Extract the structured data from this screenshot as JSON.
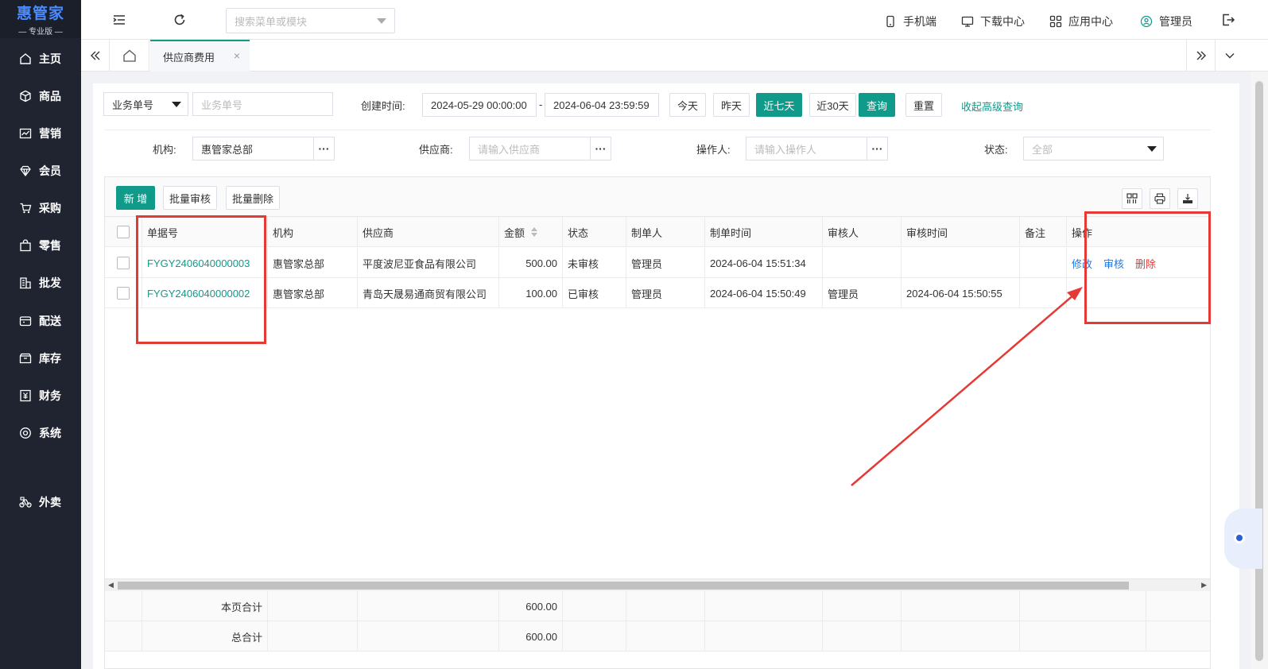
{
  "logo": {
    "main": "惠管家",
    "sub": "— 专业版 —"
  },
  "sidebar": {
    "items": [
      {
        "label": "主页",
        "icon": "home-icon"
      },
      {
        "label": "商品",
        "icon": "box-icon"
      },
      {
        "label": "营销",
        "icon": "chart-icon"
      },
      {
        "label": "会员",
        "icon": "diamond-icon"
      },
      {
        "label": "采购",
        "icon": "cart-icon"
      },
      {
        "label": "零售",
        "icon": "shop-bag-icon"
      },
      {
        "label": "批发",
        "icon": "building-icon"
      },
      {
        "label": "配送",
        "icon": "delivery-icon"
      },
      {
        "label": "库存",
        "icon": "inventory-icon"
      },
      {
        "label": "财务",
        "icon": "finance-icon"
      },
      {
        "label": "系统",
        "icon": "settings-icon"
      },
      {
        "label": "外卖",
        "icon": "bike-icon"
      }
    ]
  },
  "topbar": {
    "search_placeholder": "搜索菜单或模块",
    "mobile": "手机端",
    "download": "下载中心",
    "apps": "应用中心",
    "user": "管理员"
  },
  "tabs": {
    "active": "供应商费用",
    "close": "×"
  },
  "filters": {
    "doc_type": "业务单号",
    "doc_placeholder": "业务单号",
    "created_label": "创建时间:",
    "date_from": "2024-05-29 00:00:00",
    "date_sep": "-",
    "date_to": "2024-06-04 23:59:59",
    "btn_today": "今天",
    "btn_yesterday": "昨天",
    "btn_7days": "近七天",
    "btn_30days": "近30天",
    "btn_query": "查询",
    "btn_reset": "重置",
    "collapse": "收起高级查询",
    "org_label": "机构:",
    "org_value": "惠管家总部",
    "supplier_label": "供应商:",
    "supplier_placeholder": "请输入供应商",
    "operator_label": "操作人:",
    "operator_placeholder": "请输入操作人",
    "status_label": "状态:",
    "status_value": "全部",
    "dots": "···"
  },
  "toolbar": {
    "add": "新 增",
    "batch_audit": "批量审核",
    "batch_delete": "批量删除"
  },
  "table": {
    "headers": [
      "单据号",
      "机构",
      "供应商",
      "金额",
      "状态",
      "制单人",
      "制单时间",
      "审核人",
      "审核时间",
      "备注",
      "操作"
    ],
    "rows": [
      {
        "no": "FYGY2406040000003",
        "org": "惠管家总部",
        "supplier": "平度波尼亚食品有限公司",
        "amount": "500.00",
        "status": "未审核",
        "maker": "管理员",
        "make_time": "2024-06-04 15:51:34",
        "auditor": "",
        "audit_time": "",
        "remark": "",
        "ops": [
          "修改",
          "审核",
          "删除"
        ]
      },
      {
        "no": "FYGY2406040000002",
        "org": "惠管家总部",
        "supplier": "青岛天晟易通商贸有限公司",
        "amount": "100.00",
        "status": "已审核",
        "maker": "管理员",
        "make_time": "2024-06-04 15:50:49",
        "auditor": "管理员",
        "audit_time": "2024-06-04 15:50:55",
        "remark": "",
        "ops": []
      }
    ],
    "page_total_label": "本页合计",
    "page_total": "600.00",
    "grand_total_label": "总合计",
    "grand_total": "600.00"
  },
  "colors": {
    "accent": "#0f9a8a",
    "sidebar": "#1f2430",
    "link_blue": "#1e7ae6",
    "danger": "#e53935"
  }
}
